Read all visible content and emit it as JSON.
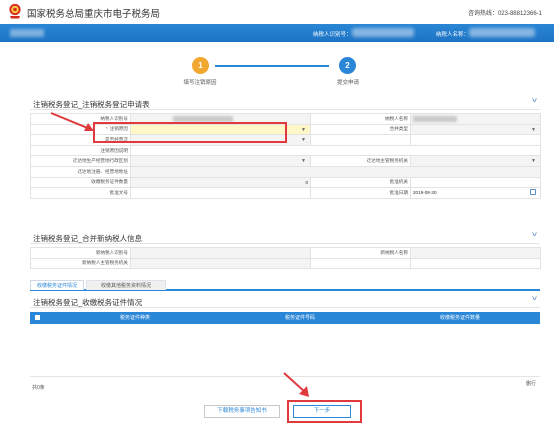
{
  "header": {
    "site_title": "国家税务总局重庆市电子税务局",
    "hotline": "咨询热线：023-88812366-1"
  },
  "bluebar": {
    "taxpayer_id_label": "纳税人识别号：",
    "taxpayer_name_label": "纳税人名称："
  },
  "steps": [
    {
      "number": "1",
      "label": "填写注销原因",
      "color": "#f0a830"
    },
    {
      "number": "2",
      "label": "提交申请",
      "color": "#2a86d6"
    }
  ],
  "section1": {
    "title": "注销税务登记_注销税务登记申请表",
    "rows": [
      {
        "l1": "纳税人识别号",
        "v1": "",
        "v1_blur": true,
        "l2": "纳税人名称",
        "v2": "",
        "v2_blur": true
      },
      {
        "l1": "注销原因",
        "required": true,
        "v1": "",
        "v1_dropdown": true,
        "highlight": true,
        "l2": "合并类型",
        "v2": "",
        "v2_dropdown": true
      },
      {
        "l1": "是否经营次",
        "v1": "",
        "v1_dropdown": true,
        "l2": "",
        "v2": ""
      },
      {
        "l1": "注销原因说明",
        "v1": "",
        "l2": "",
        "v2": ""
      },
      {
        "l1": "迁达地生产经营地行政区划",
        "v1": "",
        "v1_dropdown": true,
        "l2": "迁达地主管税务机关",
        "v2": "",
        "v2_dropdown": true
      },
      {
        "l1": "迁达地注册、经营地地址",
        "v1": "",
        "l2": "",
        "v2": ""
      },
      {
        "l1": "收缴税务证件数量",
        "v1": "0",
        "l2": "批准机关",
        "v2": ""
      },
      {
        "l1": "批准文号",
        "v1": "",
        "l2": "批准日期",
        "v2": "2019-08-30",
        "v2_calendar": true
      }
    ]
  },
  "section2": {
    "title": "注销税务登记_合并新纳税人信息",
    "rows": [
      {
        "l1": "新纳税人识别号",
        "v1": "",
        "l2": "新纳税人名称",
        "v2": ""
      },
      {
        "l1": "新纳税人主管税务机关",
        "v1": "",
        "l2": "",
        "v2": ""
      }
    ]
  },
  "tabs": [
    {
      "label": "收缴税务证件情况",
      "active": true
    },
    {
      "label": "收缴其他税务资料情况",
      "active": false
    }
  ],
  "section3": {
    "title": "注销税务登记_收缴税务证件情况",
    "columns": [
      "税务证件种类",
      "税务证件号码",
      "收缴税务证件数量"
    ],
    "record_count": "共0条",
    "delete_label": "删行"
  },
  "buttons": {
    "download": "下载税务事项告知书",
    "next": "下一步"
  },
  "colors": {
    "brand_blue": "#2a86d6",
    "annotation_red": "#e0393e",
    "highlight_yellow": "#fff7c8"
  }
}
